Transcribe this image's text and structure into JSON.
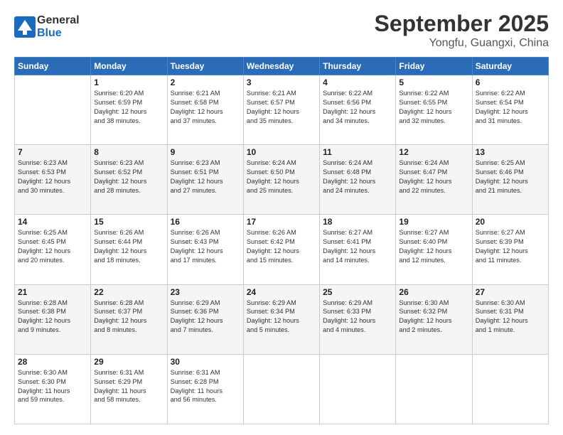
{
  "logo": {
    "general": "General",
    "blue": "Blue"
  },
  "header": {
    "month": "September 2025",
    "location": "Yongfu, Guangxi, China"
  },
  "weekdays": [
    "Sunday",
    "Monday",
    "Tuesday",
    "Wednesday",
    "Thursday",
    "Friday",
    "Saturday"
  ],
  "weeks": [
    [
      {
        "day": "",
        "info": ""
      },
      {
        "day": "1",
        "info": "Sunrise: 6:20 AM\nSunset: 6:59 PM\nDaylight: 12 hours\nand 38 minutes."
      },
      {
        "day": "2",
        "info": "Sunrise: 6:21 AM\nSunset: 6:58 PM\nDaylight: 12 hours\nand 37 minutes."
      },
      {
        "day": "3",
        "info": "Sunrise: 6:21 AM\nSunset: 6:57 PM\nDaylight: 12 hours\nand 35 minutes."
      },
      {
        "day": "4",
        "info": "Sunrise: 6:22 AM\nSunset: 6:56 PM\nDaylight: 12 hours\nand 34 minutes."
      },
      {
        "day": "5",
        "info": "Sunrise: 6:22 AM\nSunset: 6:55 PM\nDaylight: 12 hours\nand 32 minutes."
      },
      {
        "day": "6",
        "info": "Sunrise: 6:22 AM\nSunset: 6:54 PM\nDaylight: 12 hours\nand 31 minutes."
      }
    ],
    [
      {
        "day": "7",
        "info": "Sunrise: 6:23 AM\nSunset: 6:53 PM\nDaylight: 12 hours\nand 30 minutes."
      },
      {
        "day": "8",
        "info": "Sunrise: 6:23 AM\nSunset: 6:52 PM\nDaylight: 12 hours\nand 28 minutes."
      },
      {
        "day": "9",
        "info": "Sunrise: 6:23 AM\nSunset: 6:51 PM\nDaylight: 12 hours\nand 27 minutes."
      },
      {
        "day": "10",
        "info": "Sunrise: 6:24 AM\nSunset: 6:50 PM\nDaylight: 12 hours\nand 25 minutes."
      },
      {
        "day": "11",
        "info": "Sunrise: 6:24 AM\nSunset: 6:48 PM\nDaylight: 12 hours\nand 24 minutes."
      },
      {
        "day": "12",
        "info": "Sunrise: 6:24 AM\nSunset: 6:47 PM\nDaylight: 12 hours\nand 22 minutes."
      },
      {
        "day": "13",
        "info": "Sunrise: 6:25 AM\nSunset: 6:46 PM\nDaylight: 12 hours\nand 21 minutes."
      }
    ],
    [
      {
        "day": "14",
        "info": "Sunrise: 6:25 AM\nSunset: 6:45 PM\nDaylight: 12 hours\nand 20 minutes."
      },
      {
        "day": "15",
        "info": "Sunrise: 6:26 AM\nSunset: 6:44 PM\nDaylight: 12 hours\nand 18 minutes."
      },
      {
        "day": "16",
        "info": "Sunrise: 6:26 AM\nSunset: 6:43 PM\nDaylight: 12 hours\nand 17 minutes."
      },
      {
        "day": "17",
        "info": "Sunrise: 6:26 AM\nSunset: 6:42 PM\nDaylight: 12 hours\nand 15 minutes."
      },
      {
        "day": "18",
        "info": "Sunrise: 6:27 AM\nSunset: 6:41 PM\nDaylight: 12 hours\nand 14 minutes."
      },
      {
        "day": "19",
        "info": "Sunrise: 6:27 AM\nSunset: 6:40 PM\nDaylight: 12 hours\nand 12 minutes."
      },
      {
        "day": "20",
        "info": "Sunrise: 6:27 AM\nSunset: 6:39 PM\nDaylight: 12 hours\nand 11 minutes."
      }
    ],
    [
      {
        "day": "21",
        "info": "Sunrise: 6:28 AM\nSunset: 6:38 PM\nDaylight: 12 hours\nand 9 minutes."
      },
      {
        "day": "22",
        "info": "Sunrise: 6:28 AM\nSunset: 6:37 PM\nDaylight: 12 hours\nand 8 minutes."
      },
      {
        "day": "23",
        "info": "Sunrise: 6:29 AM\nSunset: 6:36 PM\nDaylight: 12 hours\nand 7 minutes."
      },
      {
        "day": "24",
        "info": "Sunrise: 6:29 AM\nSunset: 6:34 PM\nDaylight: 12 hours\nand 5 minutes."
      },
      {
        "day": "25",
        "info": "Sunrise: 6:29 AM\nSunset: 6:33 PM\nDaylight: 12 hours\nand 4 minutes."
      },
      {
        "day": "26",
        "info": "Sunrise: 6:30 AM\nSunset: 6:32 PM\nDaylight: 12 hours\nand 2 minutes."
      },
      {
        "day": "27",
        "info": "Sunrise: 6:30 AM\nSunset: 6:31 PM\nDaylight: 12 hours\nand 1 minute."
      }
    ],
    [
      {
        "day": "28",
        "info": "Sunrise: 6:30 AM\nSunset: 6:30 PM\nDaylight: 11 hours\nand 59 minutes."
      },
      {
        "day": "29",
        "info": "Sunrise: 6:31 AM\nSunset: 6:29 PM\nDaylight: 11 hours\nand 58 minutes."
      },
      {
        "day": "30",
        "info": "Sunrise: 6:31 AM\nSunset: 6:28 PM\nDaylight: 11 hours\nand 56 minutes."
      },
      {
        "day": "",
        "info": ""
      },
      {
        "day": "",
        "info": ""
      },
      {
        "day": "",
        "info": ""
      },
      {
        "day": "",
        "info": ""
      }
    ]
  ]
}
